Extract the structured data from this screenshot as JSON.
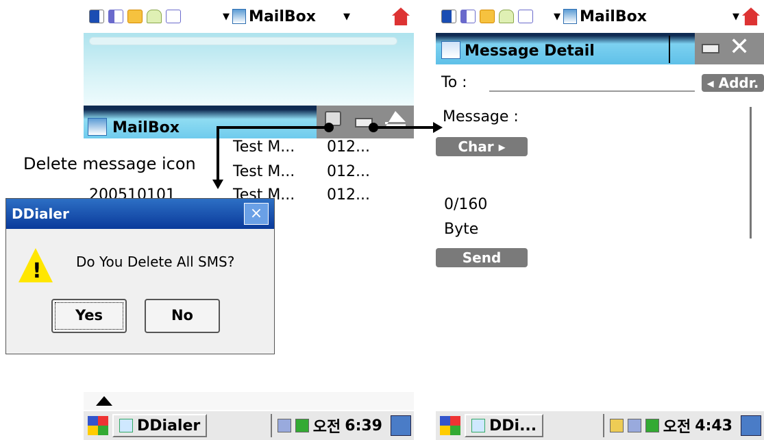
{
  "left": {
    "status": {
      "app_title": "MailBox"
    },
    "header": {
      "title": "MailBox"
    },
    "rows": [
      {
        "date": "",
        "subject": "Test M...",
        "number": "012..."
      },
      {
        "date": "",
        "subject": "Test M...",
        "number": "012..."
      },
      {
        "date": "200510101",
        "subject": "Test M...",
        "number": "012..."
      }
    ],
    "dialog": {
      "title": "DDialer",
      "close": "×",
      "message": "Do You Delete All SMS?",
      "yes": "Yes",
      "no": "No"
    },
    "callout": "Delete message icon",
    "taskbar": {
      "task": "DDialer",
      "ampm": "오전",
      "time": "6:39"
    }
  },
  "right": {
    "status": {
      "app_title": "MailBox"
    },
    "header": {
      "title": "Message Detail",
      "close": "✕"
    },
    "to_label": "To :",
    "addr_button": "Addr.",
    "message_label": "Message :",
    "char_button": "Char",
    "counter": "0/160",
    "unit": "Byte",
    "send_button": "Send",
    "taskbar": {
      "task": "DDi...",
      "ampm": "오전",
      "time": "4:43"
    }
  }
}
